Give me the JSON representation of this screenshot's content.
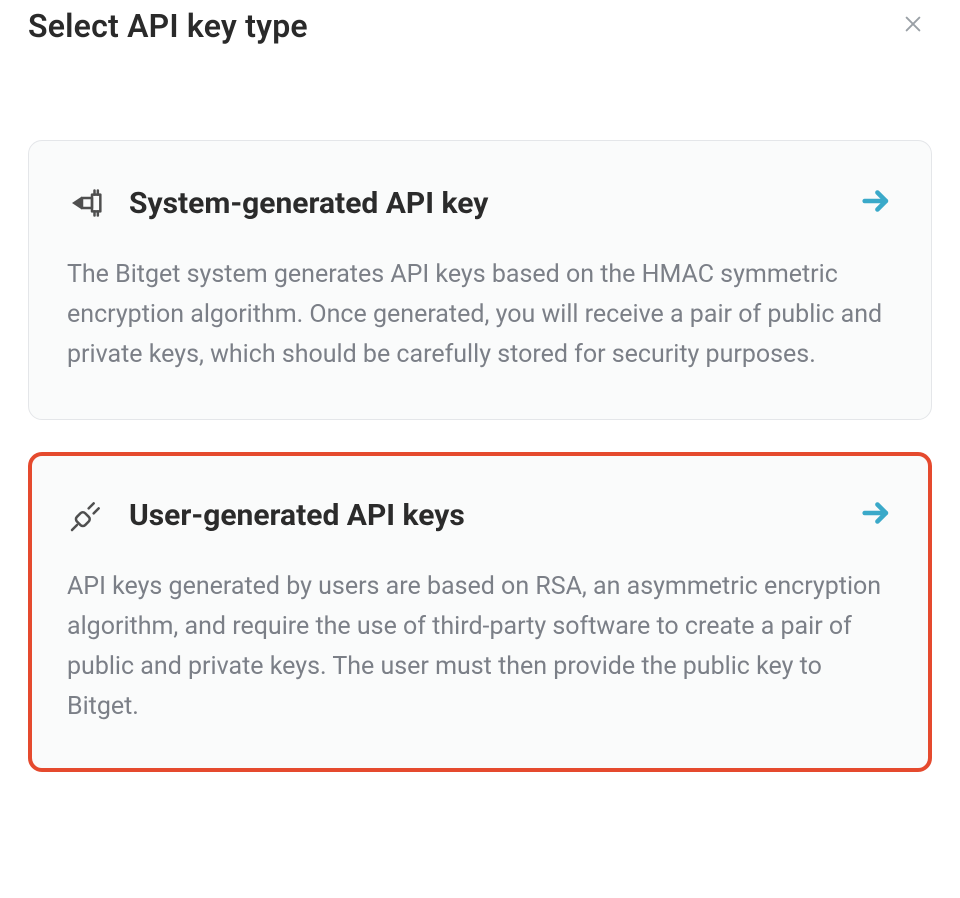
{
  "modal": {
    "title": "Select API key type"
  },
  "options": [
    {
      "icon": "usb-chip",
      "title": "System-generated API key",
      "description": "The Bitget system generates API keys based on the HMAC symmetric encryption algorithm. Once generated, you will receive a pair of public and private keys, which should be carefully stored for security purposes.",
      "highlighted": false
    },
    {
      "icon": "plug",
      "title": "User-generated API keys",
      "description": "API keys generated by users are based on RSA, an asymmetric encryption algorithm, and require the use of third-party software to create a pair of public and private keys. The user must then provide the public key to Bitget.",
      "highlighted": true
    }
  ]
}
